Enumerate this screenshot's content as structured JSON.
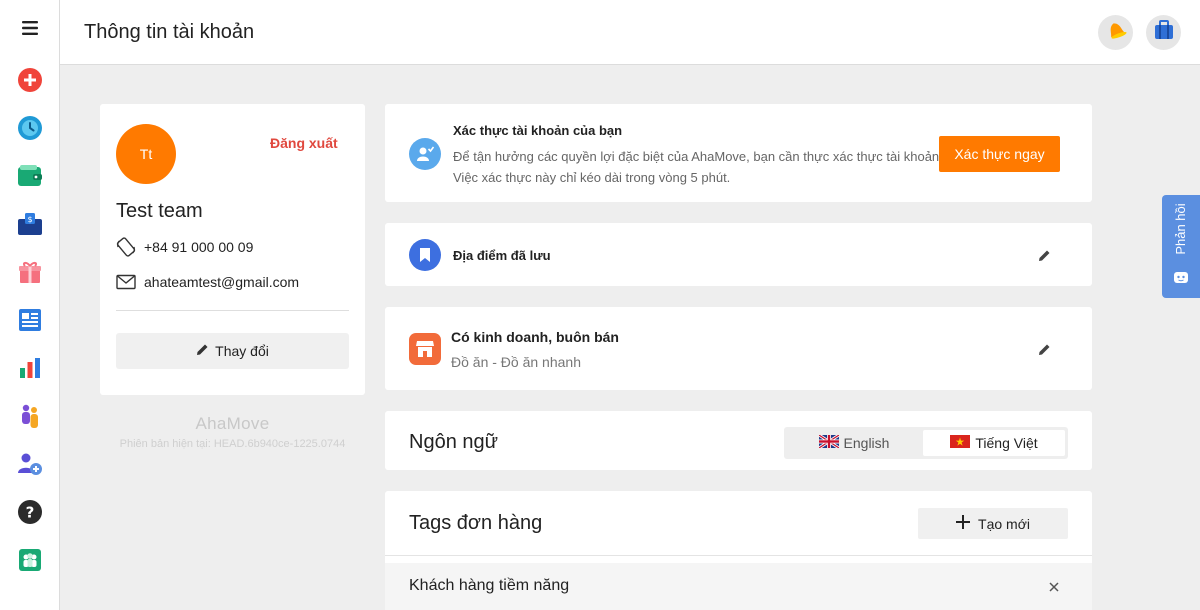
{
  "header": {
    "title": "Thông tin tài khoản"
  },
  "sidebar": {
    "items": [
      {
        "name": "menu-icon"
      },
      {
        "name": "create-order-icon"
      },
      {
        "name": "history-clock-icon"
      },
      {
        "name": "wallet-icon"
      },
      {
        "name": "cod-bag-icon"
      },
      {
        "name": "gift-icon"
      },
      {
        "name": "report-icon"
      },
      {
        "name": "chart-icon"
      },
      {
        "name": "driver-icon"
      },
      {
        "name": "add-user-icon"
      },
      {
        "name": "help-icon"
      },
      {
        "name": "team-icon"
      }
    ]
  },
  "profile": {
    "initials": "Tt",
    "logout_label": "Đăng xuất",
    "name": "Test team",
    "phone": "+84 91 000 00 09",
    "email": "ahateamtest@gmail.com",
    "change_label": "Thay đổi"
  },
  "footer": {
    "brand": "AhaMove",
    "version": "Phiên bản hiện tại: HEAD.6b940ce-1225.0744"
  },
  "verify": {
    "title": "Xác thực tài khoản của bạn",
    "desc": "Để tận hưởng các quyền lợi đặc biệt của AhaMove, bạn cần thực xác thực tài khoản. Việc xác thực này chỉ kéo dài trong vòng 5 phút.",
    "button": "Xác thực ngay"
  },
  "saved": {
    "title": "Địa điểm đã lưu"
  },
  "business": {
    "title": "Có kinh doanh, buôn bán",
    "subtitle": "Đồ ăn - Đồ ăn nhanh"
  },
  "language": {
    "title": "Ngôn ngữ",
    "options": [
      "English",
      "Tiếng Việt"
    ],
    "selected": "Tiếng Việt"
  },
  "tags": {
    "title": "Tags đơn hàng",
    "create_label": "Tạo mới",
    "items": [
      "Khách hàng tiềm năng"
    ]
  },
  "feedback": {
    "label": "Phản hồi"
  },
  "colors": {
    "accent": "#ff7a00",
    "logout": "#e0483e",
    "feedback": "#5b8fe0"
  }
}
